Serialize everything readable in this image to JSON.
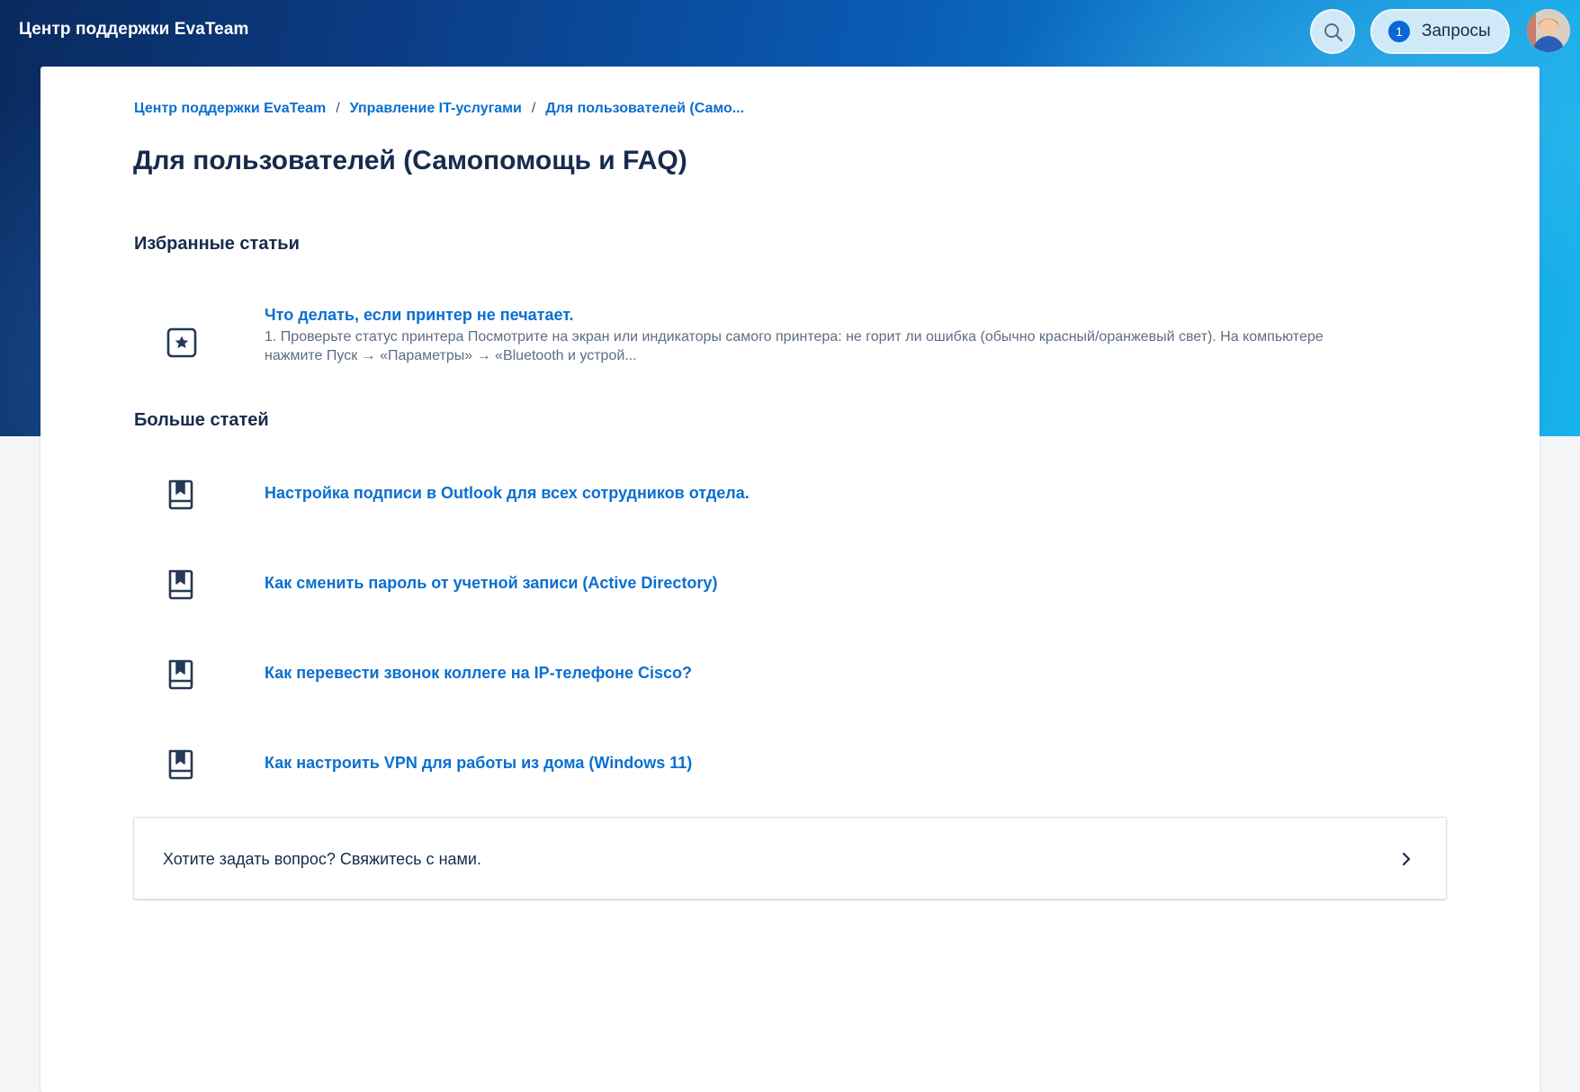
{
  "header": {
    "site_title": "Центр поддержки EvaTeam",
    "requests_count": "1",
    "requests_label": "Запросы"
  },
  "breadcrumb": [
    {
      "label": "Центр поддержки EvaTeam"
    },
    {
      "label": "Управление IT-услугами"
    },
    {
      "label": "Для пользователей (Само..."
    }
  ],
  "page": {
    "title": "Для пользователей (Самопомощь и FAQ)"
  },
  "featured": {
    "heading": "Избранные статьи",
    "items": [
      {
        "title": "Что делать, если принтер не печатает.",
        "excerpt": "1. Проверьте статус принтера Посмотрите на экран или индикаторы самого принтера: не горит ли ошибка (обычно красный/оранжевый свет). На компьютере нажмите Пуск → «Параметры» → «Bluetooth и устрой...",
        "icon": "star-icon"
      }
    ]
  },
  "more": {
    "heading": "Больше статей",
    "items": [
      {
        "title": "Настройка подписи в Outlook для всех сотрудников отдела.",
        "icon": "book-icon"
      },
      {
        "title": "Как сменить пароль от учетной записи (Active Directory)",
        "icon": "book-icon"
      },
      {
        "title": "Как перевести звонок коллеге на IP-телефоне Cisco?",
        "icon": "book-icon"
      },
      {
        "title": "Как настроить VPN для работы из дома (Windows 11)",
        "icon": "book-icon"
      }
    ]
  },
  "contact": {
    "text": "Хотите задать вопрос? Свяжитесь с нами."
  },
  "colors": {
    "link": "#0b6fd0",
    "text": "#172b4d",
    "muted": "#5e6c84",
    "badge": "#0b66d8",
    "header_start": "#0a2a5e",
    "header_end": "#18b4ec"
  }
}
